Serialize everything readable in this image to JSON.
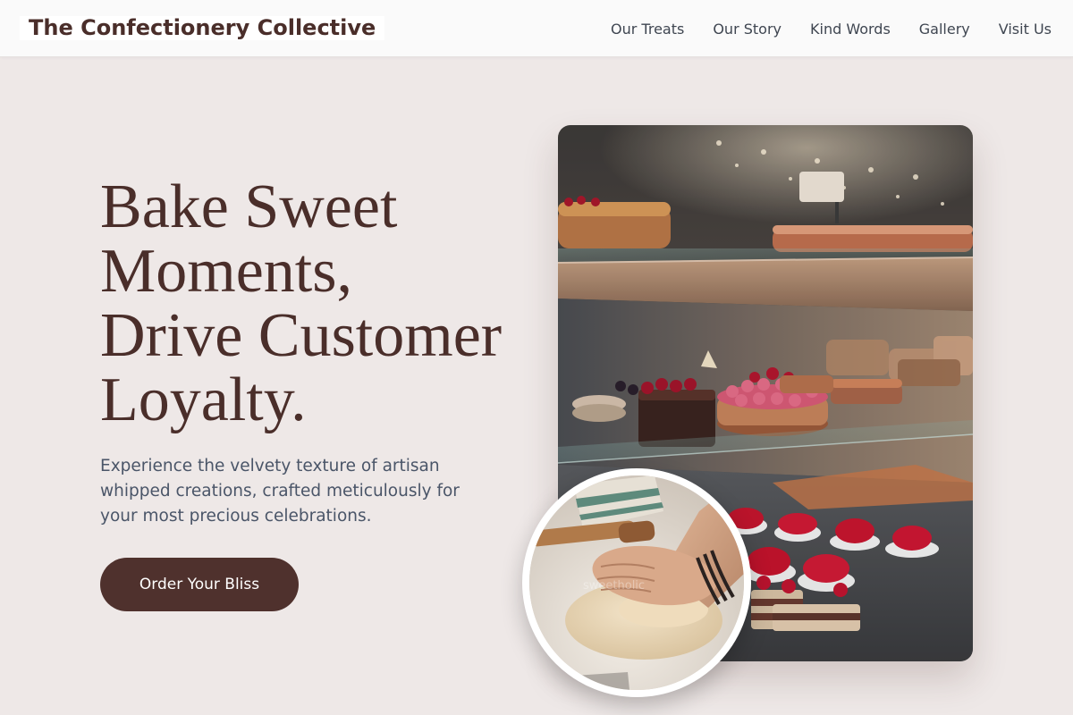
{
  "brand": {
    "name": "The Confectionery Collective"
  },
  "nav": {
    "items": [
      {
        "label": "Our Treats"
      },
      {
        "label": "Our Story"
      },
      {
        "label": "Kind Words"
      },
      {
        "label": "Gallery"
      },
      {
        "label": "Visit Us"
      }
    ]
  },
  "hero": {
    "title_lines": [
      "Bake Sweet",
      "Moments,",
      "Drive Customer",
      "Loyalty."
    ],
    "subtitle_lines": [
      "Experience the velvety texture of artisan",
      "whipped creations, crafted meticulously for",
      "your most precious celebrations."
    ],
    "cta_label": "Order Your Bliss"
  },
  "images": {
    "main_photo": "bakery-display-case-photo",
    "circle_photo": "hands-kneading-dough-photo",
    "watermark": "sweetholic"
  },
  "colors": {
    "brand": "#4a2e2a",
    "cta_background": "#4f312d",
    "page_background": "#eee8e7",
    "nav_background": "#fafafa",
    "body_text": "#4a5568"
  }
}
